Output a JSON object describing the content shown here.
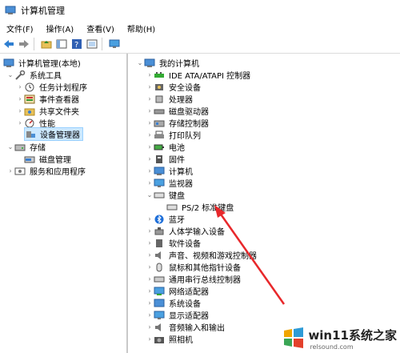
{
  "window": {
    "title": "计算机管理"
  },
  "menu": [
    "文件(F)",
    "操作(A)",
    "查看(V)",
    "帮助(H)"
  ],
  "left_tree": {
    "root": "计算机管理(本地)",
    "system_tools": "系统工具",
    "task_scheduler": "任务计划程序",
    "event_viewer": "事件查看器",
    "shared_folders": "共享文件夹",
    "performance": "性能",
    "device_manager": "设备管理器",
    "storage": "存储",
    "disk_management": "磁盘管理",
    "services_apps": "服务和应用程序"
  },
  "device_tree": {
    "root": "我的计算机",
    "categories": [
      "IDE ATA/ATAPI 控制器",
      "安全设备",
      "处理器",
      "磁盘驱动器",
      "存储控制器",
      "打印队列",
      "电池",
      "固件",
      "计算机",
      "监视器",
      "键盘"
    ],
    "keyboard_child": "PS/2 标准键盘",
    "categories_after": [
      "蓝牙",
      "人体学输入设备",
      "软件设备",
      "声音、视频和游戏控制器",
      "鼠标和其他指针设备",
      "通用串行总线控制器",
      "网络适配器",
      "系统设备",
      "显示适配器",
      "音频输入和输出",
      "照相机"
    ]
  },
  "watermark": {
    "text": "win11系统之家",
    "url": "relsound.com"
  },
  "colors": {
    "arrow": "#e8282b",
    "selection": "#cce8ff"
  }
}
